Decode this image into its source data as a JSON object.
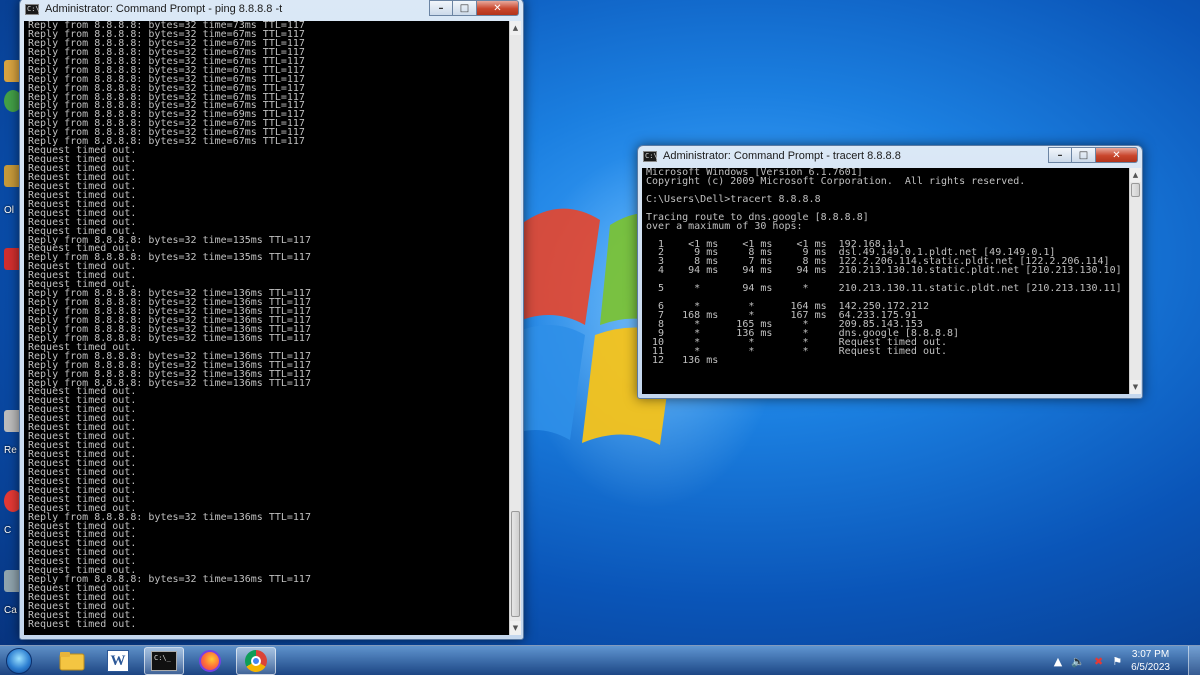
{
  "desktop": {
    "labels": [
      {
        "text": "Ol"
      },
      {
        "text": "Re"
      },
      {
        "text": "C"
      },
      {
        "text": "Ca"
      }
    ]
  },
  "ping_window": {
    "title": "Administrator: Command Prompt - ping  8.8.8.8 -t",
    "lines": [
      "Reply from 8.8.8.8: bytes=32 time=73ms TTL=117",
      "Reply from 8.8.8.8: bytes=32 time=67ms TTL=117",
      "Reply from 8.8.8.8: bytes=32 time=67ms TTL=117",
      "Reply from 8.8.8.8: bytes=32 time=67ms TTL=117",
      "Reply from 8.8.8.8: bytes=32 time=67ms TTL=117",
      "Reply from 8.8.8.8: bytes=32 time=67ms TTL=117",
      "Reply from 8.8.8.8: bytes=32 time=67ms TTL=117",
      "Reply from 8.8.8.8: bytes=32 time=67ms TTL=117",
      "Reply from 8.8.8.8: bytes=32 time=67ms TTL=117",
      "Reply from 8.8.8.8: bytes=32 time=67ms TTL=117",
      "Reply from 8.8.8.8: bytes=32 time=69ms TTL=117",
      "Reply from 8.8.8.8: bytes=32 time=67ms TTL=117",
      "Reply from 8.8.8.8: bytes=32 time=67ms TTL=117",
      "Reply from 8.8.8.8: bytes=32 time=67ms TTL=117",
      "Request timed out.",
      "Request timed out.",
      "Request timed out.",
      "Request timed out.",
      "Request timed out.",
      "Request timed out.",
      "Request timed out.",
      "Request timed out.",
      "Request timed out.",
      "Request timed out.",
      "Reply from 8.8.8.8: bytes=32 time=135ms TTL=117",
      "Request timed out.",
      "Reply from 8.8.8.8: bytes=32 time=135ms TTL=117",
      "Request timed out.",
      "Request timed out.",
      "Request timed out.",
      "Reply from 8.8.8.8: bytes=32 time=136ms TTL=117",
      "Reply from 8.8.8.8: bytes=32 time=136ms TTL=117",
      "Reply from 8.8.8.8: bytes=32 time=136ms TTL=117",
      "Reply from 8.8.8.8: bytes=32 time=136ms TTL=117",
      "Reply from 8.8.8.8: bytes=32 time=136ms TTL=117",
      "Reply from 8.8.8.8: bytes=32 time=136ms TTL=117",
      "Request timed out.",
      "Reply from 8.8.8.8: bytes=32 time=136ms TTL=117",
      "Reply from 8.8.8.8: bytes=32 time=136ms TTL=117",
      "Reply from 8.8.8.8: bytes=32 time=136ms TTL=117",
      "Reply from 8.8.8.8: bytes=32 time=136ms TTL=117",
      "Request timed out.",
      "Request timed out.",
      "Request timed out.",
      "Request timed out.",
      "Request timed out.",
      "Request timed out.",
      "Request timed out.",
      "Request timed out.",
      "Request timed out.",
      "Request timed out.",
      "Request timed out.",
      "Request timed out.",
      "Request timed out.",
      "Request timed out.",
      "Reply from 8.8.8.8: bytes=32 time=136ms TTL=117",
      "Request timed out.",
      "Request timed out.",
      "Request timed out.",
      "Request timed out.",
      "Request timed out.",
      "Request timed out.",
      "Reply from 8.8.8.8: bytes=32 time=136ms TTL=117",
      "Request timed out.",
      "Request timed out.",
      "Request timed out.",
      "Request timed out.",
      "Request timed out.",
      "_"
    ]
  },
  "tracert_window": {
    "title": "Administrator: Command Prompt - tracert  8.8.8.8",
    "lines": [
      "Microsoft Windows [Version 6.1.7601]",
      "Copyright (c) 2009 Microsoft Corporation.  All rights reserved.",
      "",
      "C:\\Users\\Dell>tracert 8.8.8.8",
      "",
      "Tracing route to dns.google [8.8.8.8]",
      "over a maximum of 30 hops:",
      "",
      "  1    <1 ms    <1 ms    <1 ms  192.168.1.1",
      "  2     9 ms     8 ms     9 ms  dsl.49.149.0.1.pldt.net [49.149.0.1]",
      "  3     8 ms     7 ms     8 ms  122.2.206.114.static.pldt.net [122.2.206.114]",
      "  4    94 ms    94 ms    94 ms  210.213.130.10.static.pldt.net [210.213.130.10]",
      "",
      "  5     *       94 ms     *     210.213.130.11.static.pldt.net [210.213.130.11]",
      "",
      "  6     *        *      164 ms  142.250.172.212",
      "  7   168 ms     *      167 ms  64.233.175.91",
      "  8     *      165 ms     *     209.85.143.153",
      "  9     *      136 ms     *     dns.google [8.8.8.8]",
      " 10     *        *        *     Request timed out.",
      " 11     *        *        *     Request timed out.",
      " 12   136 ms"
    ]
  },
  "taskbar": {
    "apps": [
      {
        "name": "Windows Explorer"
      },
      {
        "name": "Microsoft Word",
        "glyph": "W"
      },
      {
        "name": "Command Prompt",
        "glyph": "C:\\_"
      },
      {
        "name": "Firefox"
      },
      {
        "name": "Google Chrome"
      }
    ],
    "time": "3:07 PM",
    "date": "6/5/2023"
  }
}
